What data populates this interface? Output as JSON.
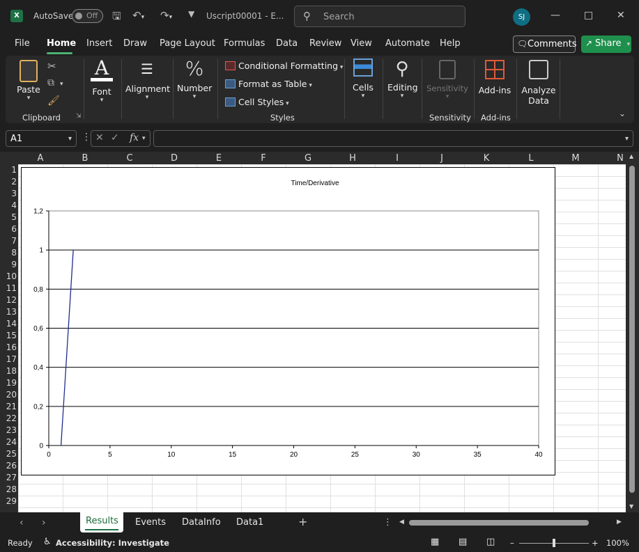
{
  "titlebar": {
    "autosave_label": "AutoSave",
    "autosave_state": "Off",
    "doc_title": "Uscript00001  -  E...",
    "search_placeholder": "Search",
    "avatar_initials": "SJ",
    "app_icon_letter": "X"
  },
  "menu": {
    "items": [
      "File",
      "Home",
      "Insert",
      "Draw",
      "Page Layout",
      "Formulas",
      "Data",
      "Review",
      "View",
      "Automate",
      "Help"
    ],
    "active": "Home",
    "comments_label": "Comments",
    "share_label": "Share"
  },
  "ribbon": {
    "paste_label": "Paste",
    "clipboard_group": "Clipboard",
    "font_label": "Font",
    "alignment_label": "Alignment",
    "number_label": "Number",
    "conditional_formatting": "Conditional Formatting",
    "format_as_table": "Format as Table",
    "cell_styles": "Cell Styles",
    "styles_group": "Styles",
    "cells_label": "Cells",
    "editing_label": "Editing",
    "sensitivity_label": "Sensitivity",
    "sensitivity_group": "Sensitivity",
    "addins_label": "Add-ins",
    "addins_group": "Add-ins",
    "analyze_label_1": "Analyze",
    "analyze_label_2": "Data"
  },
  "formula_bar": {
    "name_box": "A1",
    "fx_label": "fx",
    "formula_value": ""
  },
  "grid": {
    "columns": [
      "A",
      "B",
      "C",
      "D",
      "E",
      "F",
      "G",
      "H",
      "I",
      "J",
      "K",
      "L",
      "M",
      "N"
    ],
    "rows": [
      "1",
      "2",
      "3",
      "4",
      "5",
      "6",
      "7",
      "8",
      "9",
      "10",
      "11",
      "12",
      "13",
      "14",
      "15",
      "16",
      "17",
      "18",
      "19",
      "20",
      "21",
      "22",
      "23",
      "24",
      "25",
      "26",
      "27",
      "28",
      "29"
    ]
  },
  "chart_data": {
    "type": "line",
    "title": "Time/Derivative",
    "xlabel": "",
    "ylabel": "",
    "xlim": [
      0,
      40
    ],
    "ylim": [
      0,
      1.2
    ],
    "x_ticks": [
      "0",
      "5",
      "10",
      "15",
      "20",
      "25",
      "30",
      "35",
      "40"
    ],
    "y_ticks": [
      "0",
      "0,2",
      "0,4",
      "0,6",
      "0,8",
      "1",
      "1,2"
    ],
    "grid": "horizontal",
    "series": [
      {
        "color": "#1f2d8a",
        "x": [
          1,
          2
        ],
        "y": [
          0,
          1
        ]
      }
    ]
  },
  "sheets": {
    "tabs": [
      "Results",
      "Events",
      "DataInfo",
      "Data1"
    ],
    "active": "Results"
  },
  "status": {
    "ready": "Ready",
    "accessibility": "Accessibility: Investigate",
    "zoom": "100%"
  }
}
